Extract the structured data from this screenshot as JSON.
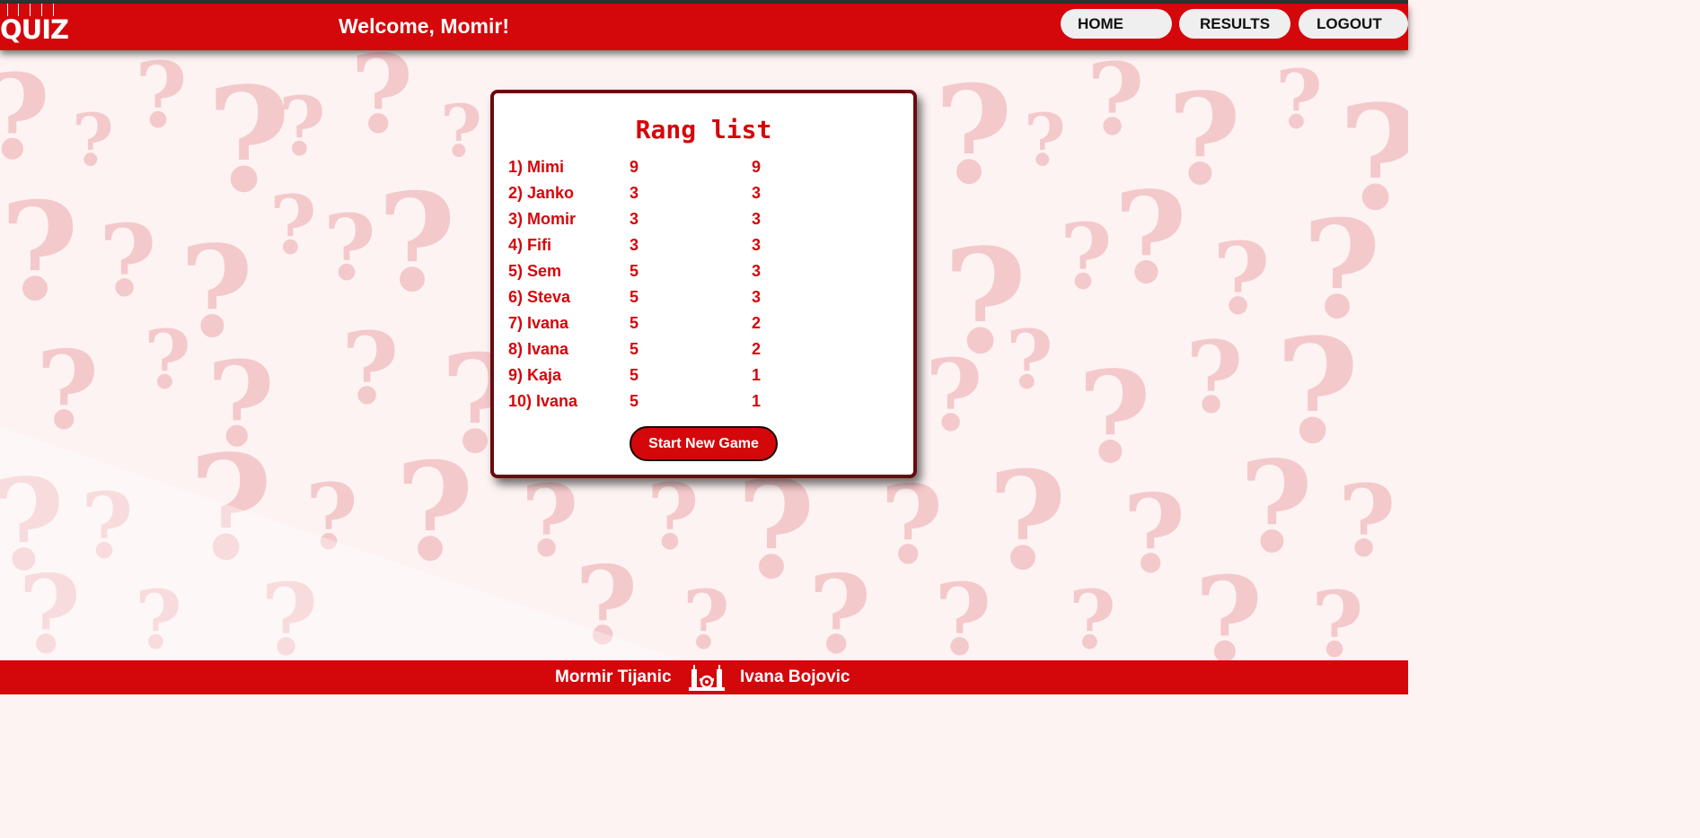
{
  "header": {
    "logo_text": "QUIZ",
    "welcome": "Welcome, Momir!",
    "nav": [
      {
        "label": "HOME"
      },
      {
        "label": "RESULTS"
      },
      {
        "label": "LOGOUT"
      }
    ]
  },
  "rank_list": {
    "title": "Rang list",
    "rows": [
      {
        "name": "1) Mimi",
        "a": "9",
        "b": "9"
      },
      {
        "name": "2) Janko",
        "a": "3",
        "b": "3"
      },
      {
        "name": "3) Momir",
        "a": "3",
        "b": "3"
      },
      {
        "name": "4) Fifi",
        "a": "3",
        "b": "3"
      },
      {
        "name": "5) Sem",
        "a": "5",
        "b": "3"
      },
      {
        "name": "6) Steva",
        "a": "5",
        "b": "3"
      },
      {
        "name": "7) Ivana",
        "a": "5",
        "b": "2"
      },
      {
        "name": "8) Ivana",
        "a": "5",
        "b": "2"
      },
      {
        "name": "9) Kaja",
        "a": "5",
        "b": "1"
      },
      {
        "name": "10) Ivana",
        "a": "5",
        "b": "1"
      }
    ],
    "start_button": "Start New Game"
  },
  "footer": {
    "author_1": "Mormir Tijanic",
    "author_2": "Ivana Bojovic",
    "icon": "gears-icon"
  },
  "colors": {
    "primary": "#d4070b",
    "card_border": "#6b0a0d",
    "nav_button": "#efefef",
    "background": "#fdf3f3"
  }
}
